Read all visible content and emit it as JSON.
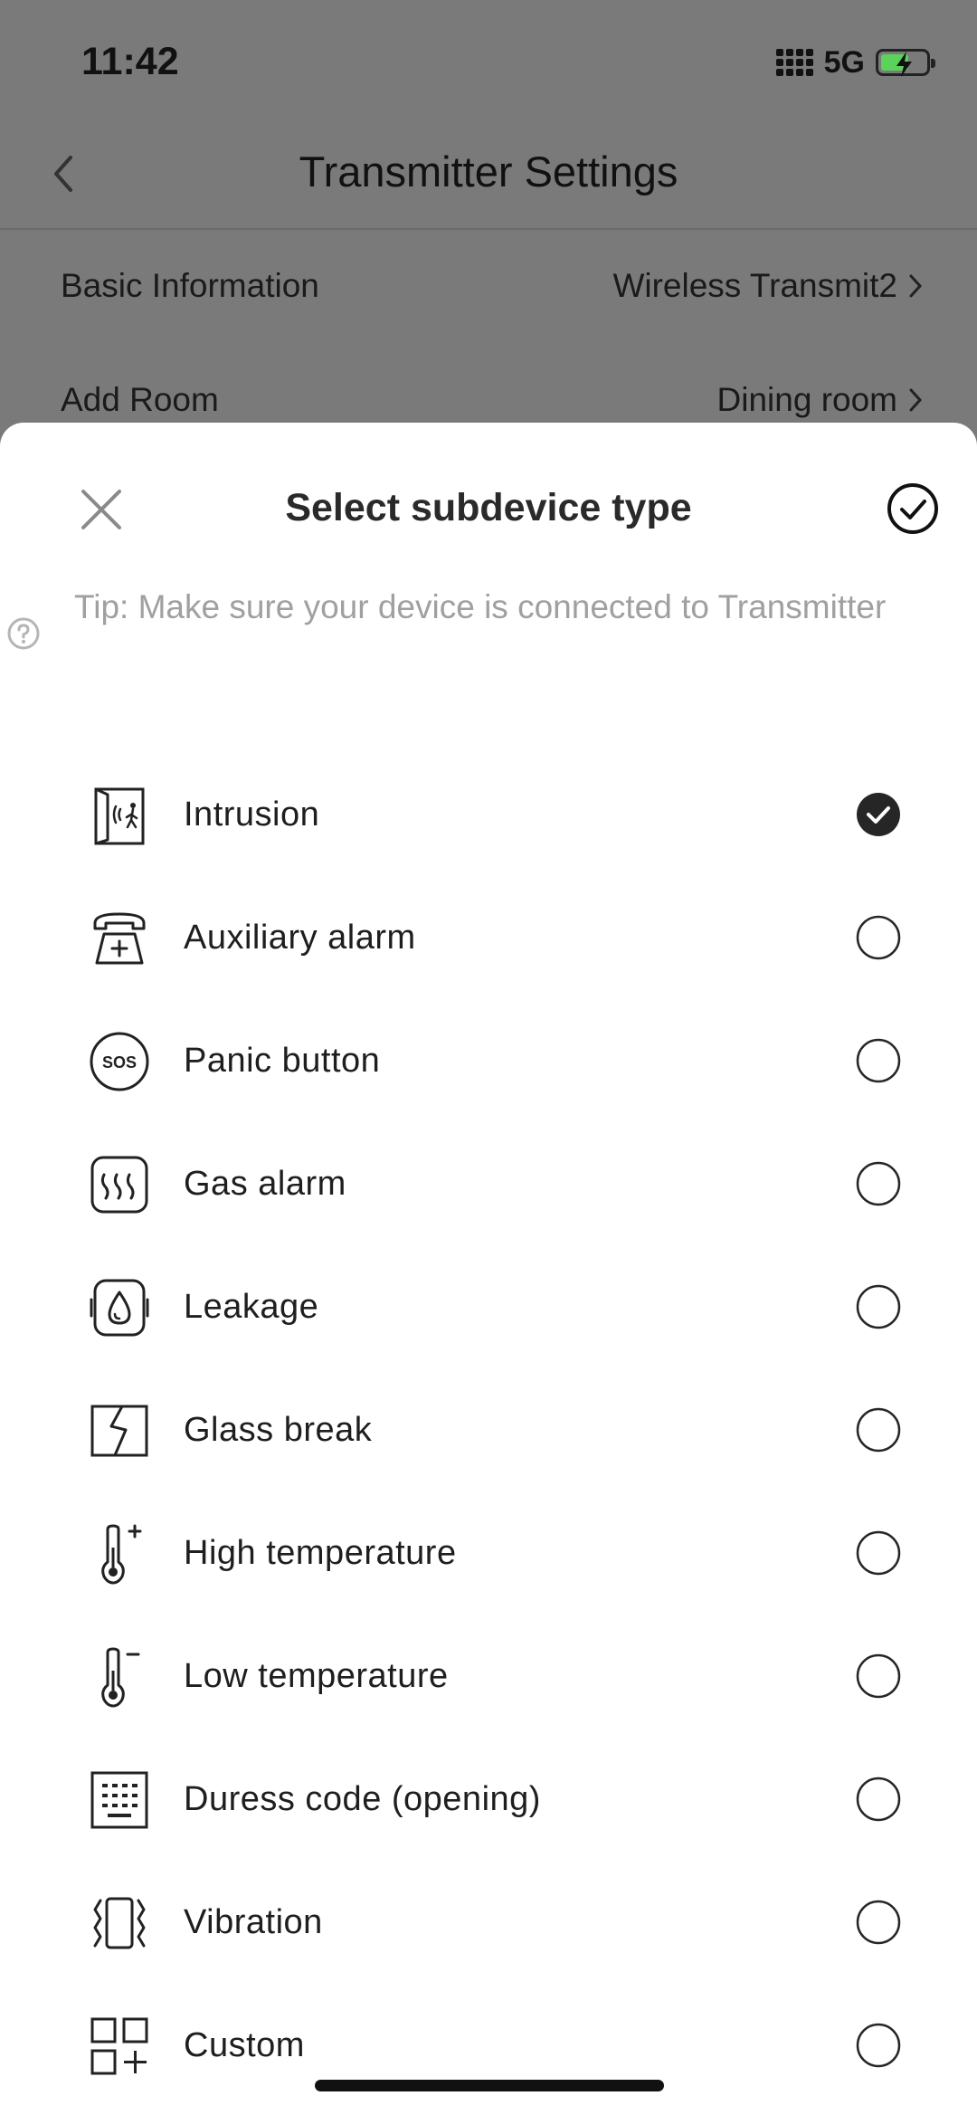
{
  "status_bar": {
    "time": "11:42",
    "network": "5G",
    "battery_color": "#5bd25a"
  },
  "nav": {
    "title": "Transmitter Settings",
    "back_icon": "chevron-left-icon"
  },
  "background_rows": [
    {
      "label": "Basic Information",
      "value": "Wireless Transmit2"
    },
    {
      "label": "Add Room",
      "value": "Dining room"
    }
  ],
  "sheet": {
    "title": "Select subdevice type",
    "close_icon": "close-icon",
    "confirm_icon": "check-circle-icon",
    "tip": "Tip: Make sure your device is connected to Transmitter",
    "tip_icon": "help-circle-icon",
    "items": [
      {
        "label": "Intrusion",
        "icon": "door-intrusion-icon",
        "selected": true
      },
      {
        "label": "Auxiliary alarm",
        "icon": "telephone-medical-icon",
        "selected": false
      },
      {
        "label": "Panic button",
        "icon": "sos-icon",
        "selected": false
      },
      {
        "label": "Gas alarm",
        "icon": "gas-icon",
        "selected": false
      },
      {
        "label": "Leakage",
        "icon": "water-drop-icon",
        "selected": false
      },
      {
        "label": "Glass break",
        "icon": "glass-break-icon",
        "selected": false
      },
      {
        "label": "High temperature",
        "icon": "thermometer-plus-icon",
        "selected": false
      },
      {
        "label": "Low temperature",
        "icon": "thermometer-minus-icon",
        "selected": false
      },
      {
        "label": "Duress code (opening)",
        "icon": "keypad-icon",
        "selected": false
      },
      {
        "label": "Vibration",
        "icon": "vibration-icon",
        "selected": false
      },
      {
        "label": "Custom",
        "icon": "custom-grid-icon",
        "selected": false
      }
    ]
  }
}
